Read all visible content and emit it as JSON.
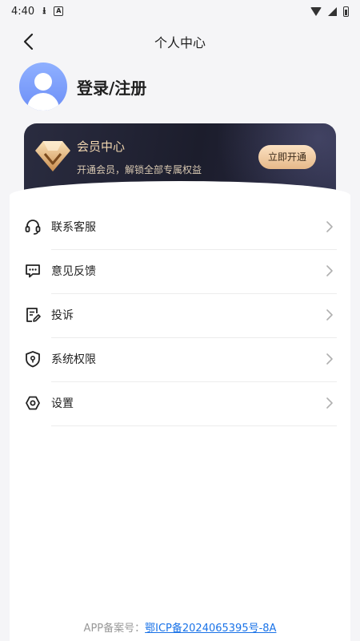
{
  "status_bar": {
    "time": "4:40"
  },
  "nav": {
    "title": "个人中心"
  },
  "profile": {
    "login_label": "登录/注册"
  },
  "vip": {
    "title": "会员中心",
    "subtitle": "开通会员，解锁全部专属权益",
    "button_label": "立即开通"
  },
  "menu": {
    "items": [
      {
        "label": "联系客服",
        "icon": "headset-icon"
      },
      {
        "label": "意见反馈",
        "icon": "feedback-chat-icon"
      },
      {
        "label": "投诉",
        "icon": "complaint-edit-icon"
      },
      {
        "label": "系统权限",
        "icon": "shield-permission-icon"
      },
      {
        "label": "设置",
        "icon": "settings-hex-icon"
      }
    ]
  },
  "footer": {
    "prefix": "APP备案号：",
    "icp_link": "鄂ICP备2024065395号-8A"
  },
  "colors": {
    "vip_gold": "#f2d7b0",
    "vip_bg": "#1c1d2c",
    "link_blue": "#1a73e8",
    "avatar_blue": "#7d9dfa"
  }
}
